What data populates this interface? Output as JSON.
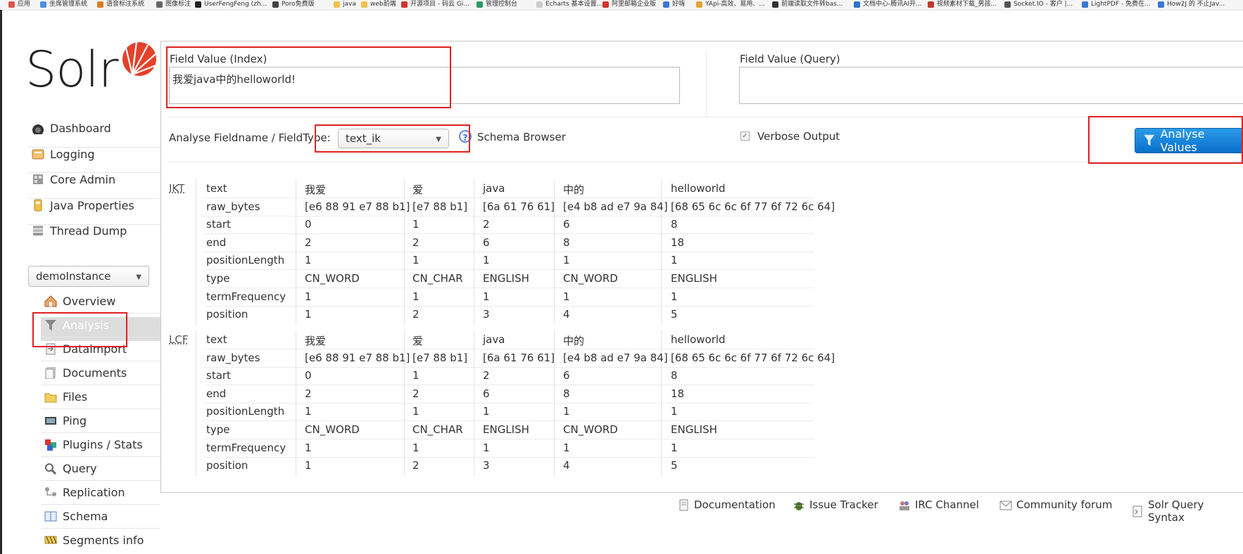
{
  "bookmarks": [
    {
      "label": "应用",
      "color": "#e0564b"
    },
    {
      "label": "坐席管理系统",
      "color": "#4a8fe0"
    },
    {
      "label": "语音标注系统",
      "color": "#e07a22"
    },
    {
      "label": "图像标注",
      "color": "#666666"
    },
    {
      "label": "UserFengFeng (zh...",
      "color": "#222222"
    },
    {
      "label": "Poro免费版",
      "color": "#444444"
    },
    {
      "label": "java",
      "color": "#f0c24b"
    },
    {
      "label": "web前端",
      "color": "#f0c24b"
    },
    {
      "label": "开源项目 - 码云 Gi...",
      "color": "#d0342c"
    },
    {
      "label": "管理控制台",
      "color": "#2b9a66"
    },
    {
      "label": "Echarts 基本设置...",
      "color": "#cccccc"
    },
    {
      "label": "阿里邮箱企业版",
      "color": "#d0342c"
    },
    {
      "label": "好嗨",
      "color": "#3a78d0"
    },
    {
      "label": "YApi-高效、易用、...",
      "color": "#e6a23c"
    },
    {
      "label": "前端读取文件转bas...",
      "color": "#333333"
    },
    {
      "label": "文档中心-腾讯AI开...",
      "color": "#2b74c8"
    },
    {
      "label": "视频素材下载_男孩...",
      "color": "#c0392b"
    },
    {
      "label": "Socket.IO - 客户 |...",
      "color": "#555555"
    },
    {
      "label": "LightPDF - 免费在...",
      "color": "#3a78d0"
    },
    {
      "label": "How2J 的 不止Jav...",
      "color": "#3a78d0"
    }
  ],
  "logo": {
    "text": "Solr"
  },
  "nav": [
    {
      "label": "Dashboard",
      "icon": "dashboard-icon"
    },
    {
      "label": "Logging",
      "icon": "logging-icon"
    },
    {
      "label": "Core Admin",
      "icon": "core-admin-icon"
    },
    {
      "label": "Java Properties",
      "icon": "java-properties-icon"
    },
    {
      "label": "Thread Dump",
      "icon": "thread-dump-icon"
    }
  ],
  "core_selector": {
    "value": "demoInstance"
  },
  "core_menu": [
    {
      "label": "Overview",
      "icon": "house-icon"
    },
    {
      "label": "Analysis",
      "icon": "funnel-icon"
    },
    {
      "label": "Dataimport",
      "icon": "dataimport-icon"
    },
    {
      "label": "Documents",
      "icon": "documents-icon"
    },
    {
      "label": "Files",
      "icon": "folder-icon"
    },
    {
      "label": "Ping",
      "icon": "ping-icon"
    },
    {
      "label": "Plugins / Stats",
      "icon": "plugins-icon"
    },
    {
      "label": "Query",
      "icon": "magnifier-icon"
    },
    {
      "label": "Replication",
      "icon": "replication-icon"
    },
    {
      "label": "Schema",
      "icon": "schema-icon"
    },
    {
      "label": "Segments info",
      "icon": "segments-icon"
    }
  ],
  "analysis": {
    "index_label": "Field Value (Index)",
    "index_value": "我爱java中的helloworld!",
    "query_label": "Field Value (Query)",
    "query_value": "",
    "fieldtype_label": "Analyse Fieldname / FieldType:",
    "fieldtype_value": "text_ik",
    "schema_browser": "Schema Browser",
    "verbose_label": "Verbose Output",
    "analyse_button": "Analyse Values"
  },
  "results": {
    "row_labels": [
      "text",
      "raw_bytes",
      "start",
      "end",
      "positionLength",
      "type",
      "termFrequency",
      "position"
    ],
    "groups": [
      {
        "name": "IKT",
        "tokens": [
          [
            "我爱",
            "[e6 88 91 e7 88 b1]",
            "0",
            "2",
            "1",
            "CN_WORD",
            "1",
            "1"
          ],
          [
            "爱",
            "[e7 88 b1]",
            "1",
            "2",
            "1",
            "CN_CHAR",
            "1",
            "2"
          ],
          [
            "java",
            "[6a 61 76 61]",
            "2",
            "6",
            "1",
            "ENGLISH",
            "1",
            "3"
          ],
          [
            "中的",
            "[e4 b8 ad e7 9a 84]",
            "6",
            "8",
            "1",
            "CN_WORD",
            "1",
            "4"
          ],
          [
            "helloworld",
            "[68 65 6c 6c 6f 77 6f 72 6c 64]",
            "8",
            "18",
            "1",
            "ENGLISH",
            "1",
            "5"
          ]
        ]
      },
      {
        "name": "LCF",
        "tokens": [
          [
            "我爱",
            "[e6 88 91 e7 88 b1]",
            "0",
            "2",
            "1",
            "CN_WORD",
            "1",
            "1"
          ],
          [
            "爱",
            "[e7 88 b1]",
            "1",
            "2",
            "1",
            "CN_CHAR",
            "1",
            "2"
          ],
          [
            "java",
            "[6a 61 76 61]",
            "2",
            "6",
            "1",
            "ENGLISH",
            "1",
            "3"
          ],
          [
            "中的",
            "[e4 b8 ad e7 9a 84]",
            "6",
            "8",
            "1",
            "CN_WORD",
            "1",
            "4"
          ],
          [
            "helloworld",
            "[68 65 6c 6c 6f 77 6f 72 6c 64]",
            "8",
            "18",
            "1",
            "ENGLISH",
            "1",
            "5"
          ]
        ]
      }
    ]
  },
  "footer": [
    {
      "label": "Documentation",
      "icon": "document-icon"
    },
    {
      "label": "Issue Tracker",
      "icon": "bug-icon"
    },
    {
      "label": "IRC Channel",
      "icon": "irc-icon"
    },
    {
      "label": "Community forum",
      "icon": "mail-icon"
    },
    {
      "label": "Solr Query Syntax",
      "icon": "query-syntax-icon"
    }
  ]
}
